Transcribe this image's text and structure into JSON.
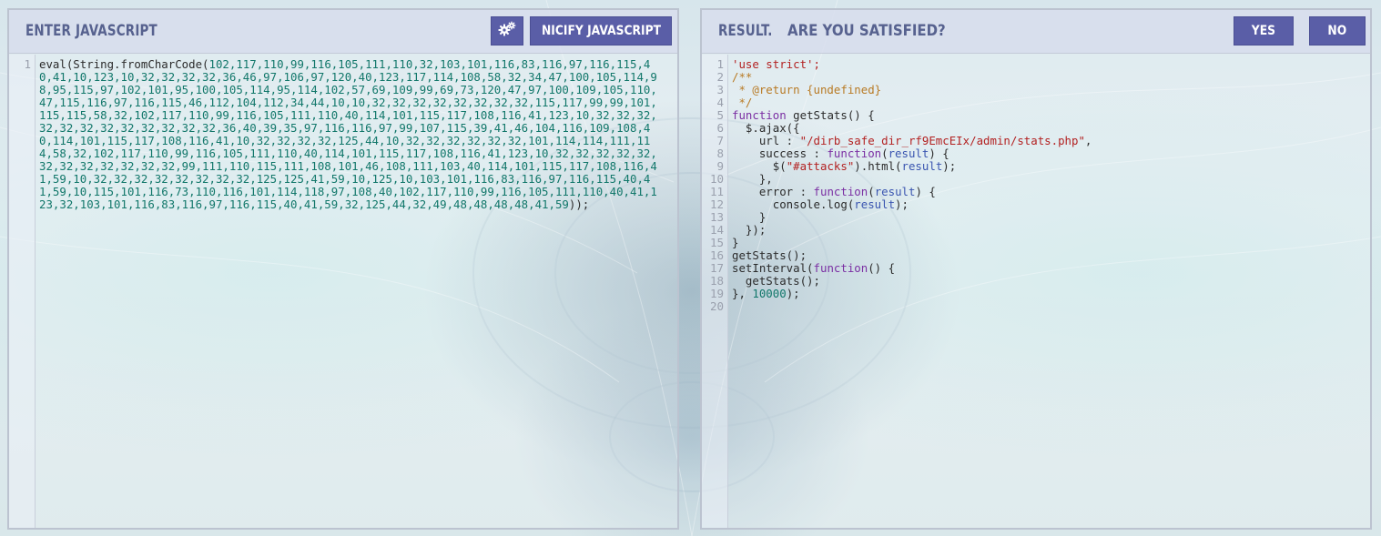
{
  "left_panel": {
    "title": "ENTER JAVASCRIPT",
    "settings_icon": "gears-icon",
    "nicify_label": "NICIFY JAVASCRIPT",
    "gutter": [
      "1"
    ],
    "code_prefix": "eval(String.fromCharCode(",
    "code_numbers": "102,117,110,99,116,105,111,110,32,103,101,116,83,116,97,116,115,40,41,10,123,10,32,32,32,32,36,46,97,106,97,120,40,123,117,114,108,58,32,34,47,100,105,114,98,95,115,97,102,101,95,100,105,114,95,114,102,57,69,109,99,69,73,120,47,97,100,109,105,110,47,115,116,97,116,115,46,112,104,112,34,44,10,10,32,32,32,32,32,32,32,32,115,117,99,99,101,115,115,58,32,102,117,110,99,116,105,111,110,40,114,101,115,117,108,116,41,123,10,32,32,32,32,32,32,32,32,32,32,32,32,36,40,39,35,97,116,116,97,99,107,115,39,41,46,104,116,109,108,40,114,101,115,117,108,116,41,10,32,32,32,32,125,44,10,32,32,32,32,32,32,101,114,114,111,114,58,32,102,117,110,99,116,105,111,110,40,114,101,115,117,108,116,41,123,10,32,32,32,32,32,32,32,32,32,32,32,32,99,111,110,115,111,108,101,46,108,111,103,40,114,101,115,117,108,116,41,59,10,32,32,32,32,32,32,32,32,125,125,41,59,10,125,10,103,101,116,83,116,97,116,115,40,41,59,10,115,101,116,73,110,116,101,114,118,97,108,40,102,117,110,99,116,105,111,110,40,41,123,32,103,101,116,83,116,97,116,115,40,41,59,32,125,44,32,49,48,48,48,48,41,59",
    "code_suffix": "));"
  },
  "right_panel": {
    "title": "RESULT.",
    "subtitle": "ARE YOU SATISFIED?",
    "yes_label": "YES",
    "no_label": "NO",
    "lines": [
      [
        {
          "t": "'use strict';",
          "c": "str"
        }
      ],
      [
        {
          "t": "/**",
          "c": "cmt"
        }
      ],
      [
        {
          "t": " * @return {undefined}",
          "c": "cmt"
        }
      ],
      [
        {
          "t": " */",
          "c": "cmt"
        }
      ],
      [
        {
          "t": "function",
          "c": "kw"
        },
        {
          "t": " getStats() {",
          "c": ""
        }
      ],
      [
        {
          "t": "  $.ajax({",
          "c": ""
        }
      ],
      [
        {
          "t": "    url : ",
          "c": ""
        },
        {
          "t": "\"/dirb_safe_dir_rf9EmcEIx/admin/stats.php\"",
          "c": "str"
        },
        {
          "t": ",",
          "c": ""
        }
      ],
      [
        {
          "t": "    success : ",
          "c": ""
        },
        {
          "t": "function",
          "c": "kw"
        },
        {
          "t": "(",
          "c": ""
        },
        {
          "t": "result",
          "c": "var"
        },
        {
          "t": ") {",
          "c": ""
        }
      ],
      [
        {
          "t": "      $(",
          "c": ""
        },
        {
          "t": "\"#attacks\"",
          "c": "str"
        },
        {
          "t": ").html(",
          "c": ""
        },
        {
          "t": "result",
          "c": "var"
        },
        {
          "t": ");",
          "c": ""
        }
      ],
      [
        {
          "t": "    },",
          "c": ""
        }
      ],
      [
        {
          "t": "    error : ",
          "c": ""
        },
        {
          "t": "function",
          "c": "kw"
        },
        {
          "t": "(",
          "c": ""
        },
        {
          "t": "result",
          "c": "var"
        },
        {
          "t": ") {",
          "c": ""
        }
      ],
      [
        {
          "t": "      console.log(",
          "c": ""
        },
        {
          "t": "result",
          "c": "var"
        },
        {
          "t": ");",
          "c": ""
        }
      ],
      [
        {
          "t": "    }",
          "c": ""
        }
      ],
      [
        {
          "t": "  });",
          "c": ""
        }
      ],
      [
        {
          "t": "}",
          "c": ""
        }
      ],
      [
        {
          "t": "getStats();",
          "c": ""
        }
      ],
      [
        {
          "t": "setInterval(",
          "c": ""
        },
        {
          "t": "function",
          "c": "kw"
        },
        {
          "t": "() {",
          "c": ""
        }
      ],
      [
        {
          "t": "  getStats();",
          "c": ""
        }
      ],
      [
        {
          "t": "}, ",
          "c": ""
        },
        {
          "t": "10000",
          "c": "num"
        },
        {
          "t": ");",
          "c": ""
        }
      ],
      []
    ]
  }
}
